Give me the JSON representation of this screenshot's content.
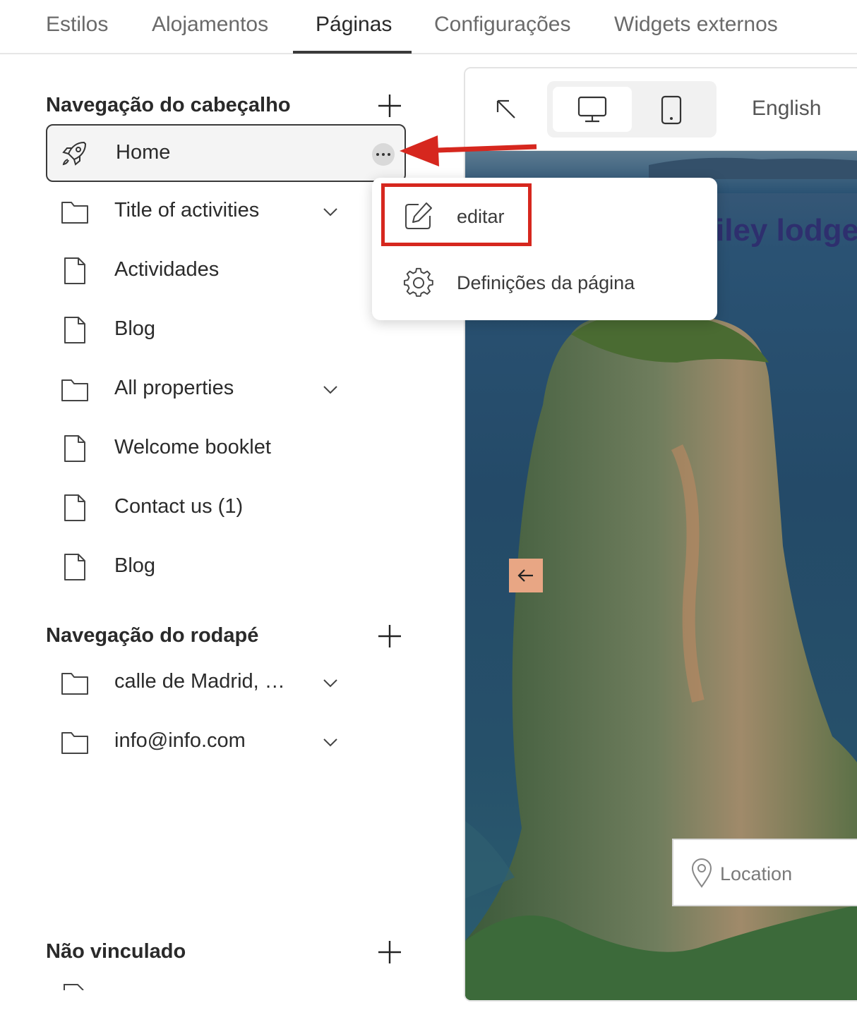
{
  "tabs": [
    {
      "label": "Estilos"
    },
    {
      "label": "Alojamentos"
    },
    {
      "label": "Páginas",
      "active": true
    },
    {
      "label": "Configurações"
    },
    {
      "label": "Widgets externos"
    }
  ],
  "sections": {
    "header_nav": {
      "title": "Navegação do cabeçalho",
      "items": [
        {
          "label": "Home",
          "icon": "rocket-icon"
        },
        {
          "label": "Title of activities",
          "icon": "folder-icon",
          "expandable": true
        },
        {
          "label": "Actividades",
          "icon": "page-icon"
        },
        {
          "label": "Blog",
          "icon": "page-icon"
        },
        {
          "label": "All properties",
          "icon": "folder-icon",
          "expandable": true
        },
        {
          "label": "Welcome booklet",
          "icon": "page-icon"
        },
        {
          "label": "Contact us (1)",
          "icon": "page-icon"
        },
        {
          "label": "Blog",
          "icon": "page-icon"
        }
      ]
    },
    "footer_nav": {
      "title": "Navegação do rodapé",
      "items": [
        {
          "label": "calle de Madrid, …",
          "icon": "folder-icon",
          "expandable": true
        },
        {
          "label": "info@info.com",
          "icon": "folder-icon",
          "expandable": true
        }
      ]
    },
    "unlinked": {
      "title": "Não vinculado"
    }
  },
  "context_menu": {
    "items": [
      {
        "label": "editar",
        "icon": "edit-icon"
      },
      {
        "label": "Definições da página",
        "icon": "gear-icon"
      }
    ]
  },
  "preview": {
    "language": "English",
    "hero_title": "iley lodge",
    "location_placeholder": "Location"
  },
  "colors": {
    "accent_red": "#d6271e",
    "arrow_button": "#e8a684",
    "hero_title": "#2e2f6e"
  }
}
